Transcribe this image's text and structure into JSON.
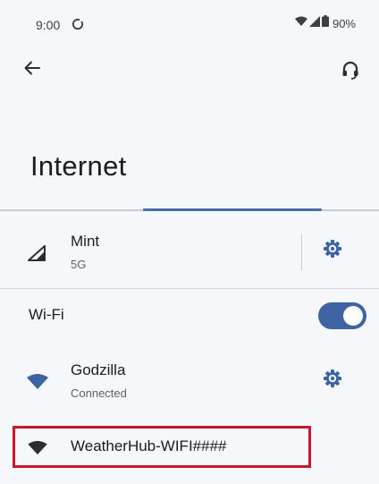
{
  "status_bar": {
    "time": "9:00",
    "battery": "90%"
  },
  "page": {
    "title": "Internet"
  },
  "mobile_network": {
    "name": "Mint",
    "type": "5G"
  },
  "wifi": {
    "label": "Wi-Fi",
    "enabled": true
  },
  "networks": [
    {
      "name": "Godzilla",
      "status": "Connected"
    },
    {
      "name": "WeatherHub-WIFI####"
    }
  ],
  "colors": {
    "accent": "#3d63a3",
    "highlight": "#c8182b",
    "background": "#f6f7fb"
  },
  "icons": {
    "back": "arrow-back-icon",
    "help": "help-icon",
    "cellular": "cellular-signal-icon",
    "settings": "gear-icon",
    "wifi": "wifi-icon"
  }
}
